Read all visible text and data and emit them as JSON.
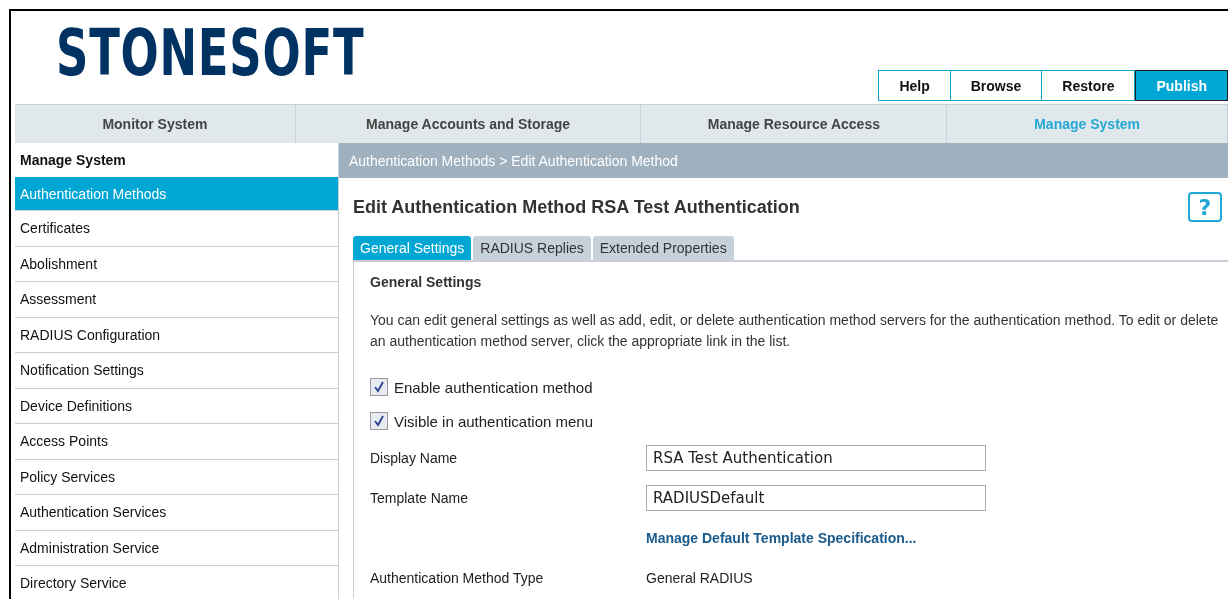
{
  "logo": "STONESOFT",
  "header_buttons": [
    {
      "label": "Help",
      "selected": false
    },
    {
      "label": "Browse",
      "selected": false
    },
    {
      "label": "Restore",
      "selected": false
    },
    {
      "label": "Publish",
      "selected": true
    }
  ],
  "nav_tabs": [
    {
      "label": "Monitor System",
      "selected": false
    },
    {
      "label": "Manage Accounts and Storage",
      "selected": false
    },
    {
      "label": "Manage Resource Access",
      "selected": false
    },
    {
      "label": "Manage System",
      "selected": true
    }
  ],
  "sidebar": {
    "title": "Manage System",
    "items": [
      {
        "label": "Authentication Methods",
        "selected": true
      },
      {
        "label": "Certificates",
        "selected": false
      },
      {
        "label": "Abolishment",
        "selected": false
      },
      {
        "label": "Assessment",
        "selected": false
      },
      {
        "label": "RADIUS Configuration",
        "selected": false
      },
      {
        "label": "Notification Settings",
        "selected": false
      },
      {
        "label": "Device Definitions",
        "selected": false
      },
      {
        "label": "Access Points",
        "selected": false
      },
      {
        "label": "Policy Services",
        "selected": false
      },
      {
        "label": "Authentication Services",
        "selected": false
      },
      {
        "label": "Administration Service",
        "selected": false
      },
      {
        "label": "Directory Service",
        "selected": false
      }
    ]
  },
  "breadcrumb": "Authentication Methods > Edit Authentication Method",
  "page_title": "Edit Authentication Method RSA Test Authentication",
  "help_button": "?",
  "tabs": [
    {
      "label": "General Settings",
      "selected": true
    },
    {
      "label": "RADIUS Replies",
      "selected": false
    },
    {
      "label": "Extended Properties",
      "selected": false
    }
  ],
  "section_title": "General Settings",
  "description": "You can edit general settings as well as add, edit, or delete authentication method servers for the authentication method. To edit or delete an authentication method server, click the appropriate link in the list.",
  "form": [
    {
      "kind": "checkbox",
      "label": "Enable authentication method",
      "checked": true
    },
    {
      "kind": "checkbox",
      "label": "Visible in authentication menu",
      "checked": true
    },
    {
      "kind": "text",
      "label": "Display Name",
      "value": "RSA Test Authentication"
    },
    {
      "kind": "text",
      "label": "Template Name",
      "value": "RADIUSDefault"
    },
    {
      "kind": "link",
      "label": "Manage Default Template Specification..."
    },
    {
      "kind": "static",
      "label": "Authentication Method Type",
      "value": "General RADIUS"
    }
  ]
}
